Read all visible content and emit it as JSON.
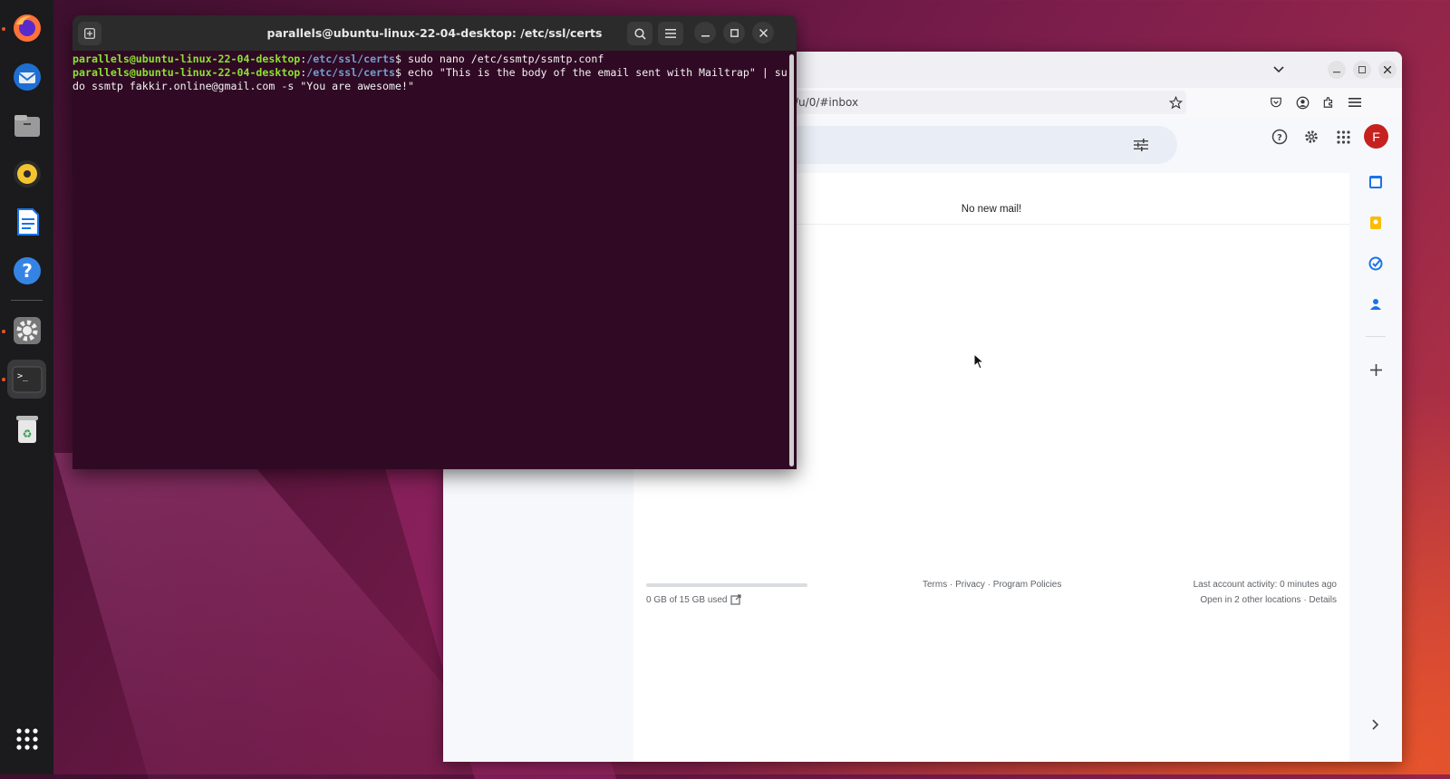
{
  "terminal": {
    "title": "parallels@ubuntu-linux-22-04-desktop: /etc/ssl/certs",
    "lines": [
      {
        "user": "parallels@ubuntu-linux-22-04-desktop",
        "sep": ":",
        "path": "/etc/ssl/certs",
        "prompt": "$ ",
        "cmd": "sudo nano /etc/ssmtp/ssmtp.conf"
      },
      {
        "user": "parallels@ubuntu-linux-22-04-desktop",
        "sep": ":",
        "path": "/etc/ssl/certs",
        "prompt": "$ ",
        "cmd": "echo \"This is the body of the email sent with Mailtrap\" | sudo ssmtp fakkir.online@gmail.com -s \"You are awesome!\""
      }
    ]
  },
  "browser": {
    "url": "/u/0/#inbox",
    "avatar_letter": "F",
    "avatar_color": "#c5221f",
    "empty_message": "No new mail!",
    "storage": {
      "text": "0 GB of 15 GB used",
      "used_fraction": 0.0
    },
    "footer_links": "Terms · Privacy · Program Policies",
    "last_activity": "Last account activity: 0 minutes ago",
    "other_locations": "Open in 2 other locations · Details"
  },
  "dock": {
    "apps": [
      "firefox-icon",
      "thunderbird-icon",
      "files-icon",
      "rhythmbox-icon",
      "writer-icon",
      "help-icon",
      "settings-icon",
      "terminal-icon",
      "trash-icon",
      "app-grid-icon"
    ]
  },
  "colors": {
    "terminal_bg": "#300a24",
    "prompt_user": "#8ae234",
    "prompt_path": "#729fcf",
    "ubuntu_orange": "#e95420"
  }
}
